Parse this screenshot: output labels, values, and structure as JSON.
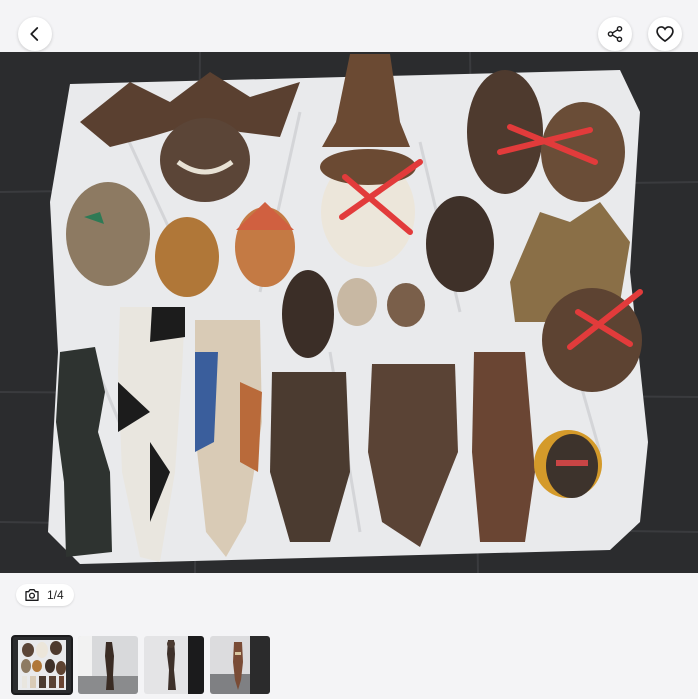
{
  "app": {
    "colors": {
      "accent": "#1c1c1e",
      "background": "#f4f4f6"
    }
  },
  "header": {
    "back_icon": "chevron-left-icon",
    "share_icon": "share-icon",
    "favorite_icon": "heart-outline-icon"
  },
  "gallery": {
    "current_index": 1,
    "total": 4,
    "counter_text": "1/4",
    "counter_icon": "camera-icon",
    "thumbnails": [
      {
        "name": "masks-collection",
        "selected": true
      },
      {
        "name": "tall-carved-figure",
        "selected": false
      },
      {
        "name": "standing-sculpture",
        "selected": false
      },
      {
        "name": "long-mask",
        "selected": false
      }
    ]
  }
}
